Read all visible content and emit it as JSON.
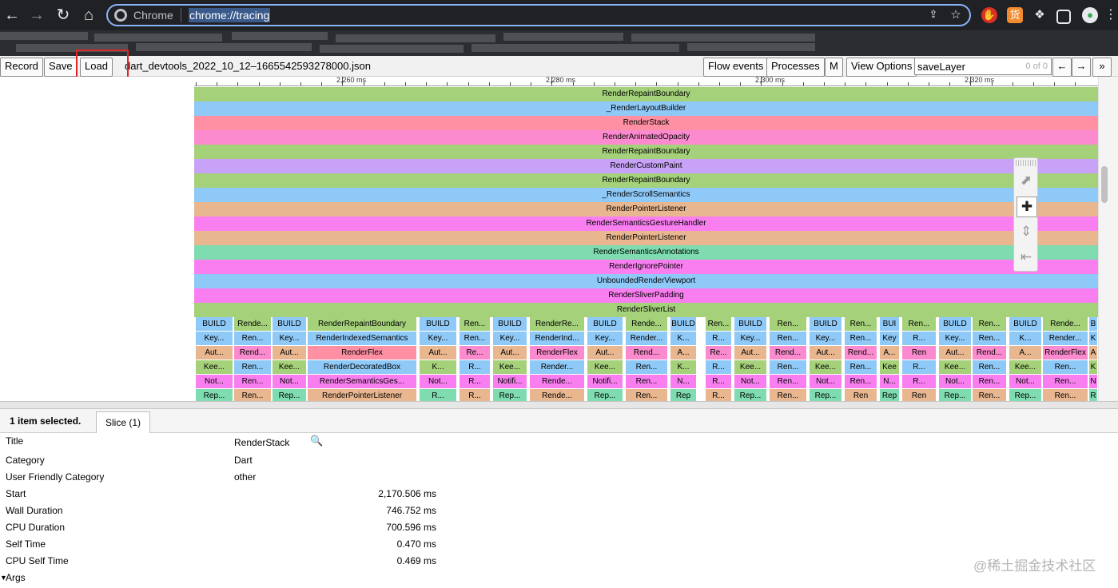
{
  "browser": {
    "tab_label": "Chrome",
    "url": "chrome://tracing"
  },
  "toolbar": {
    "record_label": "Record",
    "save_label": "Save",
    "load_label": "Load",
    "filename": "dart_devtools_2022_10_12–1665542593278000.json",
    "flow_events_label": "Flow events",
    "processes_label": "Processes",
    "m_label": "M",
    "view_options_label": "View Options",
    "search_value": "saveLayer",
    "search_count": "0 of 0",
    "prev_label": "←",
    "next_label": "→",
    "more_label": "»"
  },
  "ruler": {
    "labels": [
      "2,260 ms",
      "2,280 ms",
      "2,300 ms",
      "2,320 ms"
    ]
  },
  "tracks": [
    {
      "label": "RenderRepaintBoundary",
      "color": "#a5d17a"
    },
    {
      "label": "_RenderLayoutBuilder",
      "color": "#8fc9f7"
    },
    {
      "label": "RenderStack",
      "color": "#ff8fa3"
    },
    {
      "label": "RenderAnimatedOpacity",
      "color": "#fb8bce"
    },
    {
      "label": "RenderRepaintBoundary",
      "color": "#a5d17a"
    },
    {
      "label": "RenderCustomPaint",
      "color": "#c8a2f6"
    },
    {
      "label": "RenderRepaintBoundary",
      "color": "#a5d17a"
    },
    {
      "label": "_RenderScrollSemantics",
      "color": "#8fc9f7"
    },
    {
      "label": "RenderPointerListener",
      "color": "#e8b68f"
    },
    {
      "label": "RenderSemanticsGestureHandler",
      "color": "#f97ff0"
    },
    {
      "label": "RenderPointerListener",
      "color": "#e8b68f"
    },
    {
      "label": "RenderSemanticsAnnotations",
      "color": "#7edcb0"
    },
    {
      "label": "RenderIgnorePointer",
      "color": "#f97ff0"
    },
    {
      "label": "UnboundedRenderViewport",
      "color": "#8fc9f7"
    },
    {
      "label": "RenderSliverPadding",
      "color": "#f97ff0"
    },
    {
      "label": "RenderSliverList",
      "color": "#a5d17a"
    }
  ],
  "cells": {
    "r0": [
      "BUILD",
      "Rende...",
      "BUILD",
      "RenderRepaintBoundary",
      "BUILD",
      "Ren...",
      "BUILD",
      "RenderRe...",
      "BUILD",
      "Rende...",
      "BUILD",
      "Ren...",
      "BUILD",
      "Ren...",
      "BUILD",
      "Ren...",
      "BUI",
      "Ren...",
      "BUILD",
      "Ren...",
      "BUILD",
      "Rende...",
      "B"
    ],
    "r1": [
      "Key...",
      "Ren...",
      "Key...",
      "RenderIndexedSemantics",
      "Key...",
      "Ren...",
      "Key...",
      "RenderInd...",
      "Key...",
      "Render...",
      "K...",
      "R...",
      "Key...",
      "Ren...",
      "Key...",
      "Ren...",
      "Key",
      "R...",
      "Key...",
      "Ren...",
      "K...",
      "Render...",
      "K"
    ],
    "r2": [
      "Aut...",
      "Rend...",
      "Aut...",
      "RenderFlex",
      "Aut...",
      "Re...",
      "Aut...",
      "RenderFlex",
      "Aut...",
      "Rend...",
      "A...",
      "Re...",
      "Aut...",
      "Rend...",
      "Aut...",
      "Rend...",
      "A...",
      "Ren",
      "Aut...",
      "Rend...",
      "A...",
      "RenderFlex",
      "A"
    ],
    "r3": [
      "Kee...",
      "Ren...",
      "Kee...",
      "RenderDecoratedBox",
      "K...",
      "R...",
      "Kee...",
      "Render...",
      "Kee...",
      "Ren...",
      "K...",
      "R...",
      "Kee...",
      "Ren...",
      "Kee...",
      "Ren...",
      "Kee",
      "R...",
      "Kee...",
      "Ren...",
      "Kee...",
      "Ren...",
      "K"
    ],
    "r4": [
      "Not...",
      "Ren...",
      "Not...",
      "RenderSemanticsGes...",
      "Not...",
      "R...",
      "Notifi...",
      "Rende...",
      "Notifi...",
      "Ren...",
      "N...",
      "R...",
      "Not...",
      "Ren...",
      "Not...",
      "Ren...",
      "N...",
      "R...",
      "Not...",
      "Ren...",
      "Not...",
      "Ren...",
      "N"
    ],
    "r5": [
      "Rep...",
      "Ren...",
      "Rep...",
      "RenderPointerListener",
      "R...",
      "R...",
      "Rep...",
      "Rende...",
      "Rep...",
      "Ren...",
      "Rep",
      "R...",
      "Rep...",
      "Ren...",
      "Rep...",
      "Ren",
      "Rep",
      "Ren",
      "Rep...",
      "Ren...",
      "Rep...",
      "Ren...",
      "R"
    ]
  },
  "selection": {
    "summary": "1 item selected.",
    "tab_label": "Slice (1)"
  },
  "details": {
    "title_label": "Title",
    "title_value": "RenderStack",
    "category_label": "Category",
    "category_value": "Dart",
    "ufc_label": "User Friendly Category",
    "ufc_value": "other",
    "start_label": "Start",
    "start_value": "2,170.506 ms",
    "wall_label": "Wall Duration",
    "wall_value": "746.752 ms",
    "cpu_label": "CPU Duration",
    "cpu_value": "700.596 ms",
    "self_label": "Self Time",
    "self_value": "0.470 ms",
    "cpuself_label": "CPU Self Time",
    "cpuself_value": "0.469 ms",
    "args_label": "Args"
  },
  "watermark": "@稀土掘金技术社区"
}
